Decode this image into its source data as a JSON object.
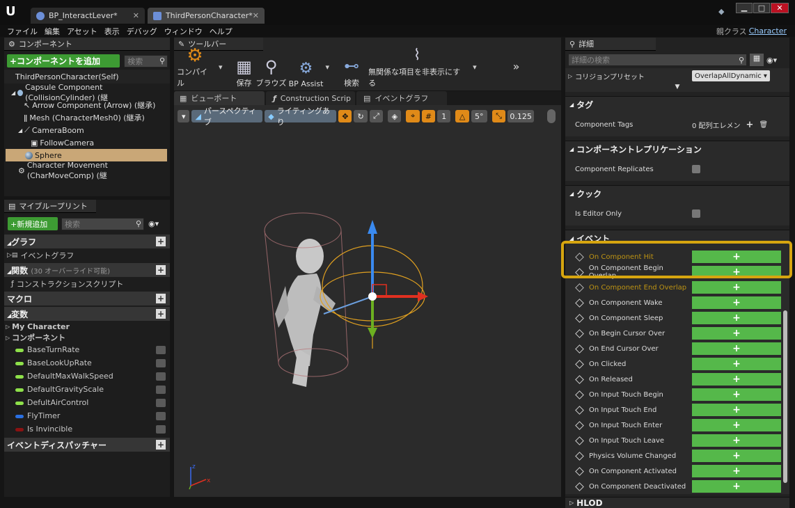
{
  "title_bar": {
    "tabs": [
      "BP_InteractLever*",
      "ThirdPersonCharacter*"
    ],
    "window_controls": [
      "minimize",
      "maximize",
      "close"
    ]
  },
  "menu": {
    "items": [
      "ファイル",
      "編集",
      "アセット",
      "表示",
      "デバッグ",
      "ウィンドウ",
      "ヘルプ"
    ],
    "parent_class_label": "親クラス",
    "parent_class_value": "Character"
  },
  "components_panel": {
    "title": "コンポーネント",
    "add_button": "+コンポーネントを追加",
    "search_placeholder": "検索",
    "tree": [
      "ThirdPersonCharacter(Self)",
      "Capsule Component (CollisionCylinder) (継",
      "Arrow Component (Arrow) (継承)",
      "Mesh (CharacterMesh0) (継承)",
      "CameraBoom",
      "FollowCamera",
      "Sphere",
      "Character Movement (CharMoveComp) (継"
    ]
  },
  "my_blueprint": {
    "title": "マイブループリント",
    "add_new": "+新規追加",
    "search_placeholder": "検索",
    "graph_label": "グラフ",
    "event_graph": "イベントグラフ",
    "functions_label": "関数",
    "functions_note": "(30 オーバーライド可能)",
    "construction_script": "コンストラクションスクリプト",
    "macro_label": "マクロ",
    "variables_label": "変数",
    "my_character": "My Character",
    "components_label": "コンポーネント",
    "variables": [
      {
        "name": "BaseTurnRate",
        "color": "#8ee04a"
      },
      {
        "name": "BaseLookUpRate",
        "color": "#8ee04a"
      },
      {
        "name": "DefaultMaxWalkSpeed",
        "color": "#8ee04a"
      },
      {
        "name": "DefaultGravityScale",
        "color": "#8ee04a"
      },
      {
        "name": "DefultAirControl",
        "color": "#8ee04a"
      },
      {
        "name": "FlyTimer",
        "color": "#2a6fe0"
      },
      {
        "name": "Is Invincible",
        "color": "#8a1212"
      }
    ],
    "dispatchers_label": "イベントディスパッチャー"
  },
  "toolbar": {
    "title": "ツールバー",
    "buttons": [
      "コンパイル",
      "保存",
      "ブラウズ",
      "BP Assist",
      "検索",
      "無関係な項目を非表示にする"
    ]
  },
  "editor_tabs": [
    "ビューポート",
    "Construction Scrip",
    "イベントグラフ"
  ],
  "viewport": {
    "perspective": "パースペクティブ",
    "lighting": "ライティングあり",
    "snap_angle": "5°",
    "scale_snap": "0.125",
    "grid_value": "1"
  },
  "details": {
    "title": "詳細",
    "search_placeholder": "詳細の検索",
    "collision_preset_label": "コリジョンプリセット",
    "collision_preset_value": "OverlapAllDynamic",
    "tags_section": "タグ",
    "component_tags_label": "Component Tags",
    "component_tags_value": "0 配列エレメン",
    "replication_section": "コンポーネントレプリケーション",
    "component_replicates": "Component Replicates",
    "cook_section": "クック",
    "is_editor_only": "Is Editor Only",
    "events_section": "イベント",
    "events": [
      "On Component Hit",
      "On Component Begin Overlap",
      "On Component End Overlap",
      "On Component Wake",
      "On Component Sleep",
      "On Begin Cursor Over",
      "On End Cursor Over",
      "On Clicked",
      "On Released",
      "On Input Touch Begin",
      "On Input Touch End",
      "On Input Touch Enter",
      "On Input Touch Leave",
      "Physics Volume Changed",
      "On Component Activated",
      "On Component Deactivated"
    ],
    "hlod_section": "HLOD",
    "add_symbol": "+"
  },
  "colors": {
    "highlight": "#d6a50f",
    "green": "#55b84a",
    "accent_orange": "#e08a18"
  }
}
